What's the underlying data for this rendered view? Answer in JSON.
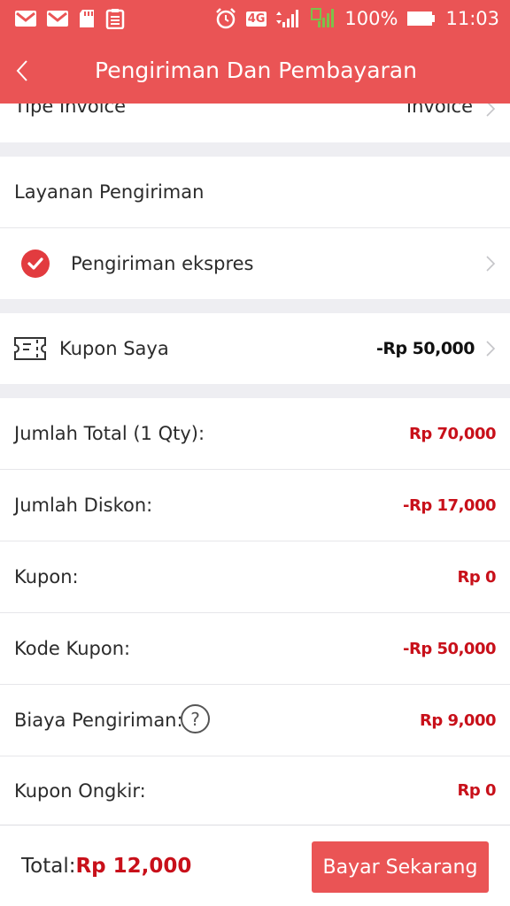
{
  "status_bar": {
    "network_badge": "4G",
    "battery_percent": "100%",
    "time": "11:03",
    "left_icons": [
      "gmail-icon",
      "gmail-icon",
      "sd-card-icon",
      "clipboard-icon"
    ]
  },
  "header": {
    "title": "Pengiriman Dan Pembayaran"
  },
  "invoice_row": {
    "label": "Tipe Invoice",
    "value": "Invoice"
  },
  "shipping": {
    "section_title": "Layanan Pengiriman",
    "selected_option": "Pengiriman ekspres"
  },
  "coupon": {
    "label": "Kupon Saya",
    "value": "-Rp 50,000"
  },
  "summary": [
    {
      "label": "Jumlah Total (1 Qty):",
      "value": "Rp 70,000"
    },
    {
      "label": "Jumlah Diskon:",
      "value": "-Rp 17,000"
    },
    {
      "label": "Kupon:",
      "value": "Rp 0"
    },
    {
      "label": "Kode Kupon:",
      "value": "-Rp 50,000"
    },
    {
      "label": "Biaya Pengiriman:",
      "value": "Rp 9,000",
      "help_icon": "?"
    },
    {
      "label": "Kupon Ongkir:",
      "value": "Rp 0"
    }
  ],
  "footer": {
    "total_label": "Total:",
    "total_value": "Rp 12,000",
    "pay_button": "Bayar Sekarang"
  },
  "colors": {
    "brand_red": "#ea5455",
    "price_red": "#c8101a",
    "section_gap": "#eeeef2"
  }
}
